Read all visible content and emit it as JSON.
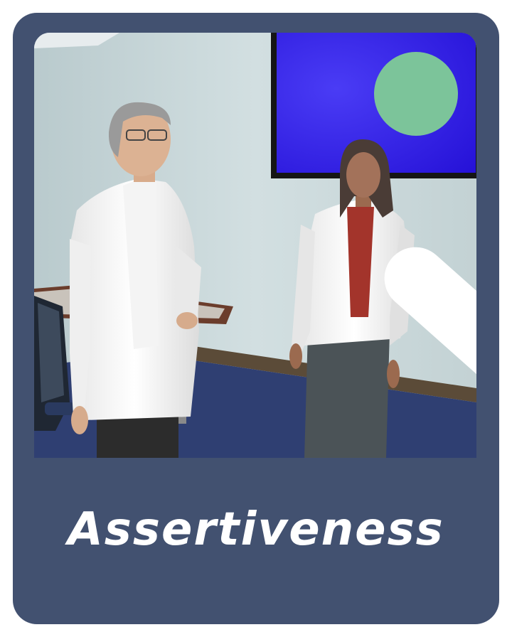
{
  "card": {
    "title": "Assertiveness",
    "status_icon": "check-icon",
    "colors": {
      "card_background": "#425170",
      "badge": "#7cc49a",
      "screen": "#2a18e0",
      "title_text": "#ffffff"
    }
  }
}
